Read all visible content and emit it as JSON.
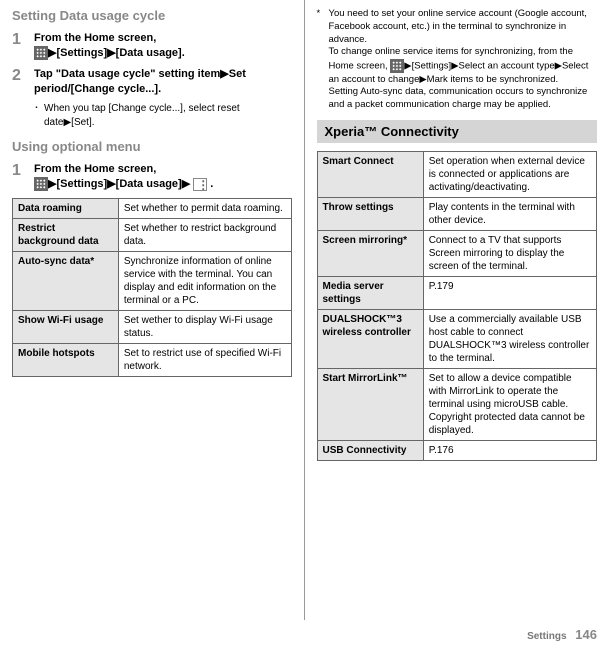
{
  "left": {
    "h_cycle": "Setting Data usage cycle",
    "step1_num": "1",
    "step1_a": "From the Home screen,",
    "step1_b": "[Settings]",
    "step1_c": "[Data usage].",
    "step2_num": "2",
    "step2_a": "Tap \"Data usage cycle\" setting item",
    "step2_b": "Set period/[Change cycle...].",
    "bullet1_dot": "･",
    "bullet1_a": "When you tap [Change cycle...], select reset date",
    "bullet1_b": "[Set].",
    "h_optional": "Using optional menu",
    "stepA_num": "1",
    "stepA_a": "From the Home screen,",
    "stepA_b": "[Settings]",
    "stepA_c": "[Data usage]",
    "stepA_d": ".",
    "t1": {
      "r1l": "Data roaming",
      "r1v": "Set whether to permit data roaming.",
      "r2l": "Restrict background data",
      "r2v": "Set whether to restrict background data.",
      "r3l": "Auto-sync data*",
      "r3v": "Synchronize information of online service with the terminal. You can display and edit information on the terminal or a PC.",
      "r4l": "Show Wi-Fi usage",
      "r4v": "Set wether to display Wi-Fi usage status.",
      "r5l": "Mobile hotspots",
      "r5v": "Set to restrict use of specified Wi-Fi network."
    }
  },
  "right": {
    "fn_mark": "*",
    "fn_a": "You need to set your online service account (Google account, Facebook account, etc.) in the terminal to synchronize in advance.",
    "fn_b": "To change online service items for synchronizing, from the Home screen, ",
    "fn_c": "[Settings]",
    "fn_d": "Select an account type",
    "fn_e": "Select an account to change",
    "fn_f": "Mark items to be synchronized.",
    "fn_g": "Setting Auto-sync data, communication occurs to synchronize and a packet communication charge may be applied.",
    "section": "Xperia™ Connectivity",
    "t2": {
      "r1l": "Smart Connect",
      "r1v": "Set operation when external device is connected or applications are activating/deactivating.",
      "r2l": "Throw settings",
      "r2v": "Play contents in the terminal with other device.",
      "r3l": "Screen mirroring*",
      "r3v": "Connect to a TV that supports Screen mirroring to display the screen of the terminal.",
      "r4l": "Media server settings",
      "r4v": "P.179",
      "r5l": "DUALSHOCK™3 wireless controller",
      "r5v": "Use a commercially available USB host cable to connect DUALSHOCK™3 wireless controller to the terminal.",
      "r6l": "Start MirrorLink™",
      "r6v": "Set to allow a device compatible with MirrorLink to operate the terminal using microUSB cable. Copyright protected data cannot be displayed.",
      "r7l": "USB Connectivity",
      "r7v": "P.176"
    }
  },
  "arrow": "▶",
  "footer": {
    "label": "Settings",
    "page": "146"
  }
}
